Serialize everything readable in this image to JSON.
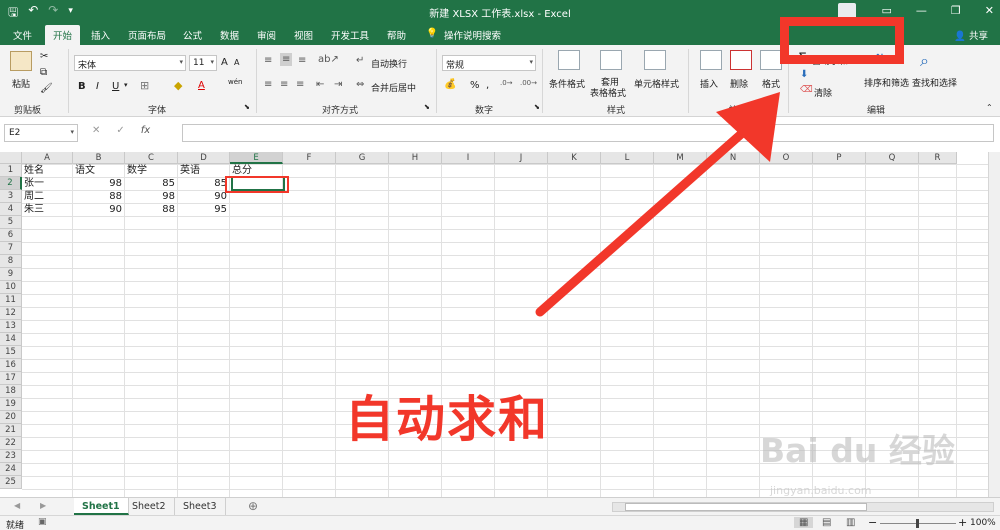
{
  "title": "新建 XLSX 工作表.xlsx  -  Excel",
  "ribbon_tabs": [
    "文件",
    "开始",
    "插入",
    "页面布局",
    "公式",
    "数据",
    "审阅",
    "视图",
    "开发工具",
    "帮助",
    "操作说明搜索"
  ],
  "share_label": "共享",
  "clipboard": {
    "paste": "粘贴",
    "group": "剪贴板"
  },
  "font": {
    "name": "宋体",
    "size": "11",
    "group": "字体",
    "bold": "B",
    "italic": "I",
    "underline": "U",
    "grow": "A",
    "shrink": "A",
    "fill_letter": "A",
    "wen": "wén"
  },
  "alignment": {
    "wrap": "自动换行",
    "merge": "合并后居中",
    "group": "对齐方式"
  },
  "number": {
    "format": "常规",
    "percent": "%",
    "comma": ",",
    "group": "数字"
  },
  "styles": {
    "conditional": "条件格式",
    "table1": "套用",
    "table2": "表格格式",
    "cell_styles": "单元格样式",
    "group": "样式"
  },
  "cells": {
    "insert": "插入",
    "delete": "删除",
    "format": "格式",
    "group": "单元格"
  },
  "editing": {
    "autosum": "自动求和",
    "clear": "清除",
    "sort": "排序和筛选",
    "find": "查找和选择",
    "group": "编辑"
  },
  "name_box": "E2",
  "fx_label": "fx",
  "columns": [
    "A",
    "B",
    "C",
    "D",
    "E",
    "F",
    "G",
    "H",
    "I",
    "J",
    "K",
    "L",
    "M",
    "N",
    "O",
    "P",
    "Q",
    "R"
  ],
  "rows": [
    "1",
    "2",
    "3",
    "4",
    "5",
    "6",
    "7",
    "8",
    "9",
    "10",
    "11",
    "12",
    "13",
    "14",
    "15",
    "16",
    "17",
    "18",
    "19",
    "20",
    "21",
    "22",
    "23",
    "24",
    "25"
  ],
  "sheet": {
    "A1": "姓名",
    "B1": "语文",
    "C1": "数学",
    "D1": "英语",
    "E1": "总分",
    "A2": "张一",
    "B2": "98",
    "C2": "85",
    "D2": "85",
    "A3": "周二",
    "B3": "88",
    "C3": "98",
    "D3": "90",
    "A4": "朱三",
    "B4": "90",
    "C4": "88",
    "D4": "95"
  },
  "sheet_tabs": [
    "Sheet1",
    "Sheet2",
    "Sheet3"
  ],
  "status": {
    "ready": "就绪",
    "zoom": "100%"
  },
  "annotation": "自动求和",
  "watermark": {
    "brand": "Bai du 经验",
    "url": "jingyan.baidu.com"
  },
  "colors": {
    "excel_green": "#217346",
    "annotation_red": "#f2372a"
  }
}
